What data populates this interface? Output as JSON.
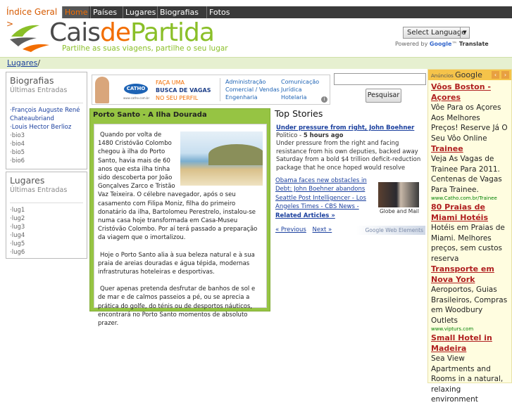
{
  "nav": {
    "crumb": "Índice Geral >",
    "tabs": [
      {
        "label": "Home",
        "active": true
      },
      {
        "label": "Países"
      },
      {
        "label": "Lugares"
      },
      {
        "label": "Biografias"
      },
      {
        "label": "Fotos"
      }
    ]
  },
  "logo": {
    "word_c": "Cais",
    "word_de": "de",
    "word_partida": "Partida",
    "tagline": "Partilhe as suas viagens, partilhe o seu lugar"
  },
  "translate": {
    "select_label": "Select Language",
    "powered_by": "Powered by",
    "google": "Google",
    "translate": "Translate"
  },
  "breadcrumb": {
    "link": "Lugares",
    "sep": "/"
  },
  "sidebar": {
    "biografias": {
      "title": "Biografias",
      "subtitle": "Últimas Entradas",
      "items": [
        {
          "label": "·François Auguste René Chateaubriand",
          "link": true
        },
        {
          "label": "·Louis Hector Berlioz",
          "link": true
        },
        {
          "label": "·bio3"
        },
        {
          "label": "·bio4"
        },
        {
          "label": "·bio5"
        },
        {
          "label": "·bio6"
        }
      ]
    },
    "lugares": {
      "title": "Lugares",
      "subtitle": "Últimas Entradas",
      "items": [
        "·lug1",
        "·lug2",
        "·lug3",
        "·lug4",
        "·lug5",
        "·lug6"
      ]
    }
  },
  "adbanner": {
    "brand": "CATHO",
    "brand_sub": "www.catho.com.br",
    "slogan_1": "FAÇA UMA",
    "slogan_2": "BUSCA DE VAGAS",
    "slogan_3": "NO SEU PERFIL",
    "col1": [
      "Administração",
      "Comercial / Vendas",
      "Engenharia"
    ],
    "col2": [
      "Comunicação",
      "Jurídica",
      "Hotelaria"
    ],
    "info": "i"
  },
  "search": {
    "button": "Pesquisar",
    "placeholder": ""
  },
  "article": {
    "title": "Porto Santo - A Ilha Dourada",
    "paragraphs": [
      "Quando por volta de 1480 Cristóvão Colombo chegou à ilha do Porto Santo, havia mais de 60 anos que esta ilha tinha sido descoberta por João Gonçalves Zarco e Tristão Vaz Teixeira. O célebre navegador, após o seu casamento com Filipa Moniz, filha do primeiro donatário da ilha, Bartolomeu Perestrelo, instalou-se numa casa hoje transformada em Casa-Museu Cristóvão Colombo. Por aí terá passado a preparação da viagem que o imortalizou.",
      "Hoje o Porto Santo alia à sua beleza natural e à sua praia de areias douradas e água tépida, modernas infrastruturas hoteleiras e desportivas.",
      "Quer apenas pretenda desfrutar de banhos de sol e de mar e de calmos passeios a pé, ou se aprecia a prática do golfe, do ténis ou de desportos náuticos, encontrará no Porto Santo momentos de absoluto prazer."
    ]
  },
  "stories": {
    "title": "Top Stories",
    "headline": "Under pressure from right, John Boehner",
    "source": "Politico",
    "age": "5 hours ago",
    "snippet": "Under pressure from the right and facing resistance from his own deputies, backed away Saturday from a bold $4 trillion deficit-reduction package that he once hoped would resolve",
    "related": [
      "Obama faces new obstacles in Debt: John Boehner abandons",
      "Seattle Post Intelligencer - Los Angeles Times - CBS News -"
    ],
    "more": "Related Articles »",
    "thumb_caption": "Globe and Mail",
    "prev": "« Previous",
    "next": "Next »",
    "brand": "Google Web Elements"
  },
  "rightads": {
    "label": "Anúncios",
    "google": "Google",
    "ads": [
      {
        "title": "Vôos Boston - Açores",
        "desc": "Vôe Para os Açores Aos Melhores Preços! Reserve Já O Seu Vôo Online",
        "url": ""
      },
      {
        "title": "Trainee",
        "desc": "Veja As Vagas de Trainee Para 2011. Centenas de Vagas Para Trainee.",
        "url": "www.Catho.com.br/Trainee"
      },
      {
        "title": "80 Praias de Miami Hotéis",
        "desc": "Hotéis em Praias de Miami. Melhores preços, sem custos reserva",
        "url": ""
      },
      {
        "title": "Transporte em Nova York",
        "desc": "Aeroportos, Guias Brasileiros, Compras em Woodbury Outlets",
        "url": "www.vipturs.com"
      },
      {
        "title": "Small Hotel in Madeira",
        "desc": "Sea View Apartments and Rooms in a natural, relaxing environment",
        "url": ""
      }
    ]
  }
}
